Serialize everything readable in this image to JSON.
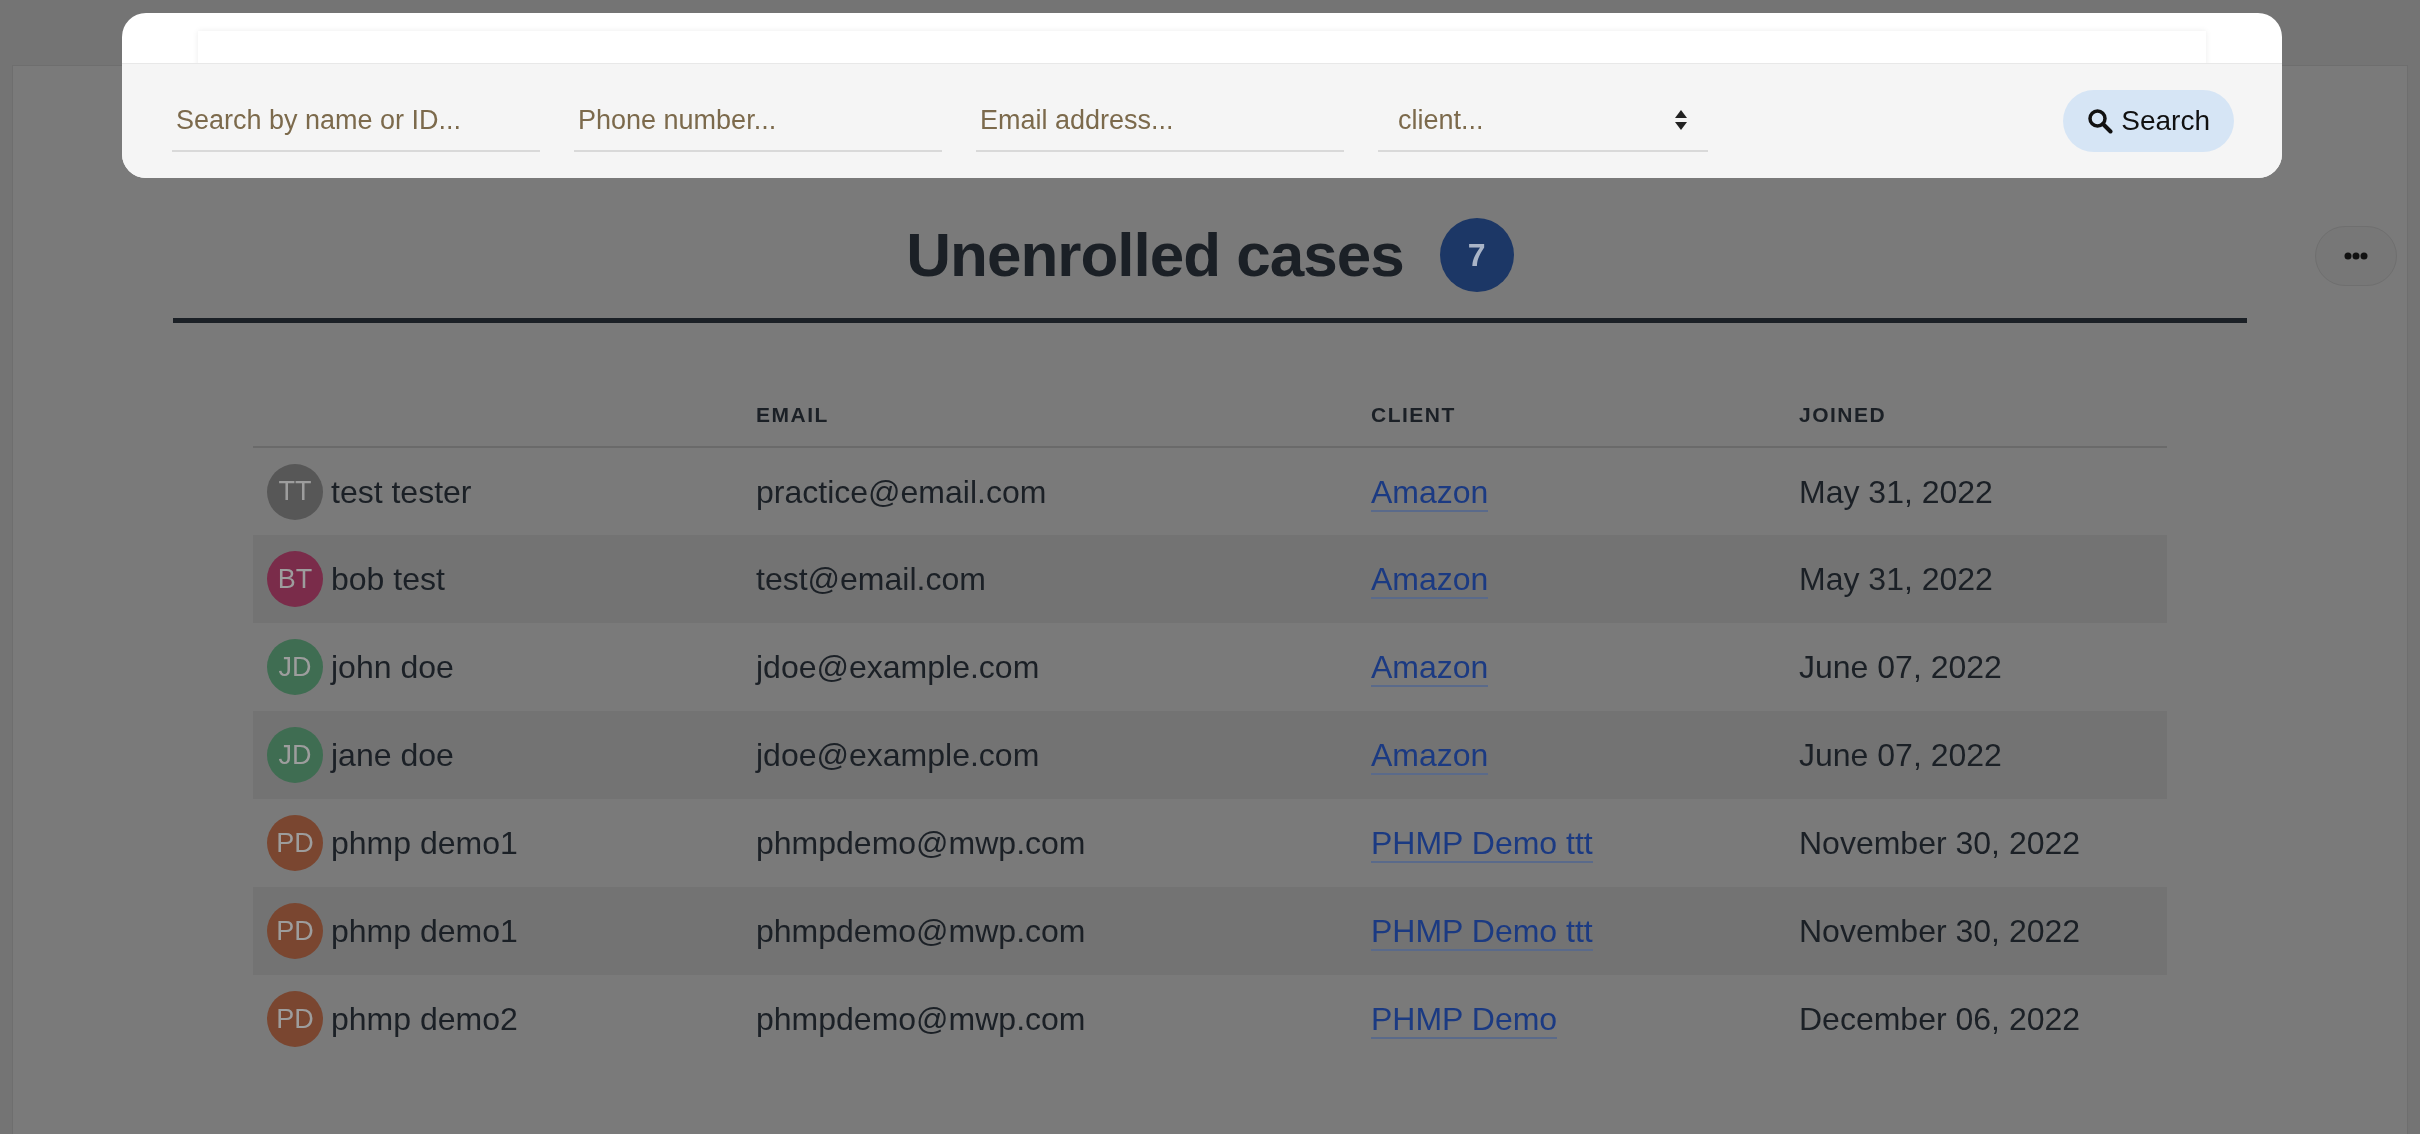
{
  "search_panel": {
    "fields": [
      {
        "placeholder": "Search by name or ID..."
      },
      {
        "placeholder": "Phone number..."
      },
      {
        "placeholder": "Email address..."
      }
    ],
    "select": {
      "value": "client..."
    },
    "button": "Search"
  },
  "heading": {
    "title": "Unenrolled cases",
    "count": "7"
  },
  "table": {
    "columns": [
      "EMAIL",
      "CLIENT",
      "JOINED"
    ],
    "rows": [
      {
        "initials": "TT",
        "color": "#575757",
        "name": "test tester",
        "email": "practice@email.com",
        "client": "Amazon",
        "joined": "May 31, 2022"
      },
      {
        "initials": "BT",
        "color": "#7a2c4a",
        "name": "bob test",
        "email": "test@email.com",
        "client": "Amazon",
        "joined": "May 31, 2022"
      },
      {
        "initials": "JD",
        "color": "#3f6d52",
        "name": "john doe",
        "email": "jdoe@example.com",
        "client": "Amazon",
        "joined": "June 07, 2022"
      },
      {
        "initials": "JD",
        "color": "#3f6d52",
        "name": "jane doe",
        "email": "jdoe@example.com",
        "client": "Amazon",
        "joined": "June 07, 2022"
      },
      {
        "initials": "PD",
        "color": "#7a4630",
        "name": "phmp demo1",
        "email": "phmpdemo@mwp.com",
        "client": "PHMP Demo ttt",
        "joined": "November 30, 2022"
      },
      {
        "initials": "PD",
        "color": "#7a4630",
        "name": "phmp demo1",
        "email": "phmpdemo@mwp.com",
        "client": "PHMP Demo ttt",
        "joined": "November 30, 2022"
      },
      {
        "initials": "PD",
        "color": "#7a4630",
        "name": "phmp demo2",
        "email": "phmpdemo@mwp.com",
        "client": "PHMP Demo",
        "joined": "December 06, 2022"
      }
    ]
  }
}
